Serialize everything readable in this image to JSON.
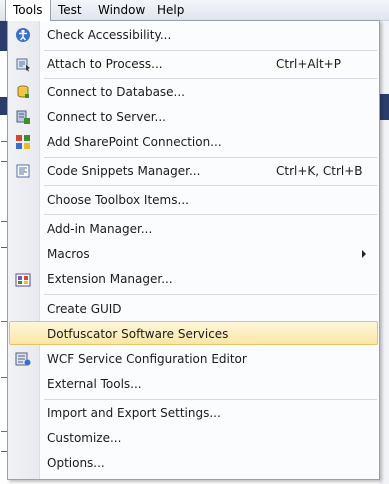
{
  "menubar": {
    "items": [
      {
        "label": "Tools"
      },
      {
        "label": "Test"
      },
      {
        "label": "Window"
      },
      {
        "label": "Help"
      }
    ]
  },
  "menu": {
    "items": [
      {
        "label": "Check Accessibility...",
        "shortcut": "",
        "icon": "accessibility-icon"
      },
      {
        "label": "Attach to Process...",
        "shortcut": "Ctrl+Alt+P",
        "icon": "attach-process-icon"
      },
      {
        "label": "Connect to Database...",
        "shortcut": "",
        "icon": "database-connect-icon"
      },
      {
        "label": "Connect to Server...",
        "shortcut": "",
        "icon": "server-connect-icon"
      },
      {
        "label": "Add SharePoint Connection...",
        "shortcut": "",
        "icon": "sharepoint-icon"
      },
      {
        "label": "Code Snippets Manager...",
        "shortcut": "Ctrl+K, Ctrl+B",
        "icon": "snippets-icon"
      },
      {
        "label": "Choose Toolbox Items...",
        "shortcut": "",
        "icon": ""
      },
      {
        "label": "Add-in Manager...",
        "shortcut": "",
        "icon": ""
      },
      {
        "label": "Macros",
        "shortcut": "",
        "icon": "",
        "submenu": true
      },
      {
        "label": "Extension Manager...",
        "shortcut": "",
        "icon": "extension-manager-icon"
      },
      {
        "label": "Create GUID",
        "shortcut": "",
        "icon": ""
      },
      {
        "label": "Dotfuscator Software Services",
        "shortcut": "",
        "icon": "",
        "highlighted": true
      },
      {
        "label": "WCF Service Configuration Editor",
        "shortcut": "",
        "icon": "wcf-editor-icon"
      },
      {
        "label": "External Tools...",
        "shortcut": "",
        "icon": ""
      },
      {
        "label": "Import and Export Settings...",
        "shortcut": "",
        "icon": ""
      },
      {
        "label": "Customize...",
        "shortcut": "",
        "icon": ""
      },
      {
        "label": "Options...",
        "shortcut": "",
        "icon": ""
      }
    ]
  },
  "colors": {
    "highlight_top": "#fdf6dc",
    "highlight_bottom": "#fbe7a4",
    "highlight_border": "#e5c365"
  }
}
